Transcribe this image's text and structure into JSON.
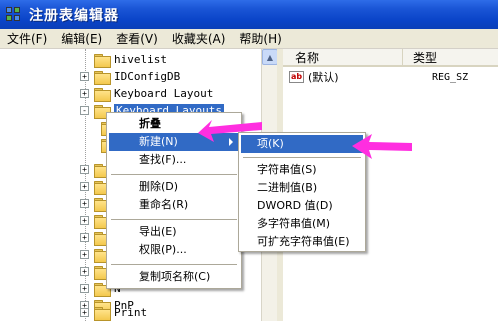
{
  "window": {
    "title": "注册表编辑器"
  },
  "menubar": [
    {
      "label": "文件(F)"
    },
    {
      "label": "编辑(E)"
    },
    {
      "label": "查看(V)"
    },
    {
      "label": "收藏夹(A)"
    },
    {
      "label": "帮助(H)"
    }
  ],
  "tree": {
    "items": [
      {
        "label": "hivelist",
        "expander": ""
      },
      {
        "label": "IDConfigDB",
        "expander": "+"
      },
      {
        "label": "Keyboard Layout",
        "expander": "+"
      },
      {
        "label": "Keyboard Layouts",
        "expander": "-",
        "selected": true
      },
      {
        "label": "D",
        "expander": "+"
      },
      {
        "label": "M",
        "expander": "+"
      },
      {
        "label": "M",
        "expander": "+"
      },
      {
        "label": "M",
        "expander": "+"
      },
      {
        "label": "M",
        "expander": "+"
      },
      {
        "label": "N",
        "expander": "+"
      },
      {
        "label": "N",
        "expander": "+"
      },
      {
        "label": "N",
        "expander": "+"
      },
      {
        "label": "PnP",
        "expander": "+"
      },
      {
        "label": "Print",
        "expander": "+"
      }
    ]
  },
  "list": {
    "columns": {
      "name": "名称",
      "type": "类型"
    },
    "rows": [
      {
        "name": "(默认)",
        "type": "REG_SZ",
        "icon": "ab"
      }
    ]
  },
  "context_menu": {
    "items": [
      {
        "label": "折叠",
        "bold": true
      },
      {
        "label": "新建(N)",
        "highlighted": true,
        "has_submenu": true
      },
      {
        "label": "查找(F)..."
      },
      {
        "label": "删除(D)"
      },
      {
        "label": "重命名(R)"
      },
      {
        "label": "导出(E)"
      },
      {
        "label": "权限(P)..."
      },
      {
        "label": "复制项名称(C)"
      }
    ]
  },
  "submenu": {
    "items": [
      {
        "label": "项(K)",
        "highlighted": true
      },
      {
        "label": "字符串值(S)"
      },
      {
        "label": "二进制值(B)"
      },
      {
        "label": "DWORD 值(D)"
      },
      {
        "label": "多字符串值(M)"
      },
      {
        "label": "可扩充字符串值(E)"
      }
    ]
  },
  "colors": {
    "titlebar": "#0A44C8",
    "highlight": "#316AC5",
    "annotation_arrow": "#FF2EE0"
  },
  "icons": {
    "app": "registry-editor-icon",
    "folder": "folder-icon",
    "value": "string-value-icon",
    "scroll_up": "scroll-up-icon"
  }
}
